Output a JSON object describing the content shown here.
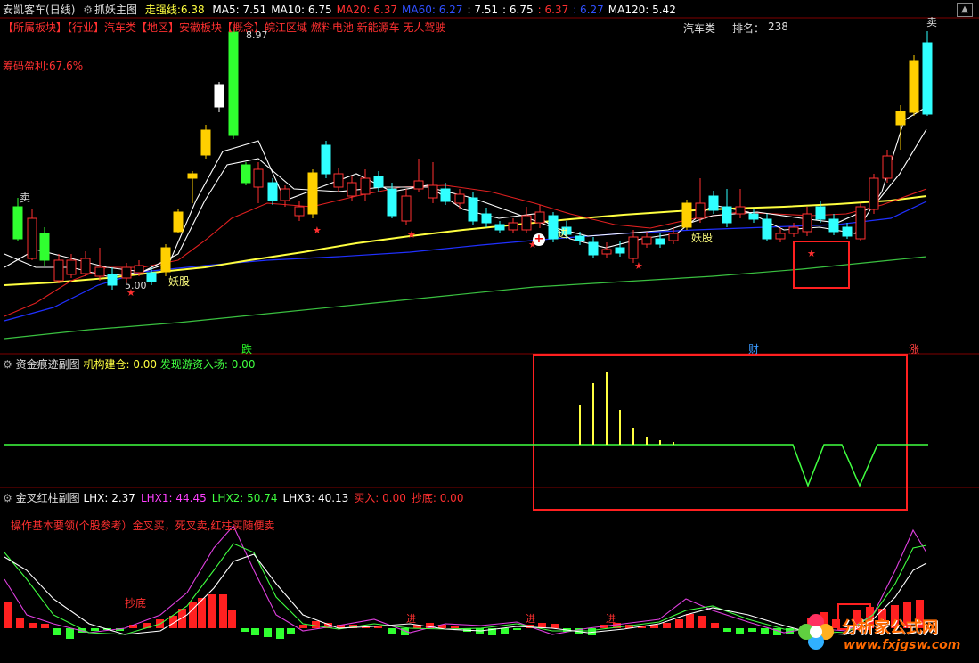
{
  "main_panel": {
    "stock_name": "安凯客车",
    "period": "(日线)",
    "indicator_name": "抓妖主图",
    "strong_line": {
      "label": "走强线:",
      "value": "6.38"
    },
    "ma": [
      {
        "label": "MA5:",
        "value": "7.51",
        "color": "#ffffff"
      },
      {
        "label": "MA10:",
        "value": "6.75",
        "color": "#ffffff"
      },
      {
        "label": "MA20:",
        "value": "6.37",
        "color": "#ff3030"
      },
      {
        "label": "MA60:",
        "value": "6.27",
        "color": "#3050ff"
      },
      {
        "label": "",
        "value": "7.51",
        "color": "#ffffff"
      },
      {
        "label": "",
        "value": "6.75",
        "color": "#ffffff"
      },
      {
        "label": "",
        "value": "6.37",
        "color": "#ff3030"
      },
      {
        "label": "",
        "value": "6.27",
        "color": "#3050ff"
      },
      {
        "label": "MA120:",
        "value": "5.42",
        "color": "#ffffff"
      }
    ],
    "sector_line": "【所属板块】【行业】汽车类【地区】安徽板块【概念】皖江区域 燃料电池 新能源车 无人驾驶",
    "sector_name": "汽车类",
    "rank": {
      "label": "排名：",
      "value": "238"
    },
    "chip_profit": "筹码盈利:67.6%",
    "high_label": "8.97",
    "low_label": "5.00",
    "sell_left": "卖",
    "sell_right": "卖",
    "yao_labels": [
      "妖股",
      "妖股",
      "妖股"
    ],
    "jin_label": "进",
    "bottom_markers": [
      {
        "text": "跌",
        "color": "#2aff2a"
      },
      {
        "text": "财",
        "color": "#3a9aff"
      },
      {
        "text": "涨",
        "color": "#ff4040"
      }
    ]
  },
  "sub_panel_1": {
    "title": "资金痕迹副图",
    "inst_label": "机构建仓:",
    "inst_value": "0.00",
    "hot_label": "发现游资入场:",
    "hot_value": "0.00"
  },
  "sub_panel_2": {
    "title": "金叉红柱副图",
    "values": [
      {
        "label": "LHX:",
        "value": "2.37",
        "color": "#ffffff"
      },
      {
        "label": "LHX1:",
        "value": "44.45",
        "color": "#ff40ff"
      },
      {
        "label": "LHX2:",
        "value": "50.74",
        "color": "#40ff40"
      },
      {
        "label": "LHX3:",
        "value": "40.13",
        "color": "#ffffff"
      },
      {
        "label": "买入:",
        "value": "0.00",
        "color": "#ff3030"
      },
      {
        "label": "抄底:",
        "value": "0.00",
        "color": "#ff3030"
      }
    ],
    "guide_text": "操作基本要领(个股参考）金叉买，死叉卖,红柱买随便卖",
    "chaodi_label": "抄底",
    "jin_labels": [
      "进",
      "进",
      "进"
    ]
  },
  "watermark": {
    "site_cn": "分析家公式网",
    "site_url": "www.fxjgsw.com"
  }
}
